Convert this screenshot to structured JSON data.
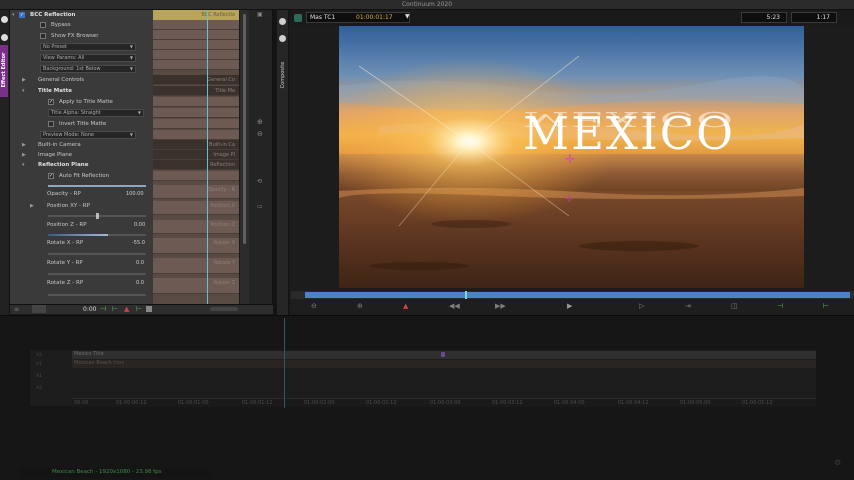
{
  "app": {
    "title": "Continuum 2020"
  },
  "side_tabs": {
    "effect_editor": "Effect Editor",
    "composite": "Composite"
  },
  "effect": {
    "name": "BCC Reflection",
    "bypass_label": "Bypass",
    "show_fx_browser_label": "Show FX Browser",
    "preset_value": "No Preset",
    "view_params_value": "View Params: All",
    "background_value": "Background: 1st Below",
    "general_controls": "General Controls",
    "title_matte": "Title Matte",
    "apply_to_title_matte": "Apply to Title Matte",
    "title_alpha_value": "Title Alpha: Straight",
    "invert_title_matte": "Invert Title Matte",
    "preview_mode_value": "Preview Mode: None",
    "built_in_camera": "Built-in Camera",
    "image_plane": "Image Plane",
    "reflection_plane": "Reflection Plane",
    "auto_fit_reflection": "Auto Fit Reflection",
    "params": [
      {
        "label": "Opacity - RP",
        "value": "100.00"
      },
      {
        "label": "Position XY - RP",
        "value": ""
      },
      {
        "label": "Position Z - RP",
        "value": "0.00"
      },
      {
        "label": "Rotate X - RP",
        "value": "-55.0"
      },
      {
        "label": "Rotate Y - RP",
        "value": "0.0"
      },
      {
        "label": "Rotate Z - RP",
        "value": "0.0"
      }
    ],
    "footer_timecode": "0:00"
  },
  "keyframes": {
    "header": "BCC Reflectio",
    "labels": [
      "General Co",
      "Title Ma",
      "Built-in Ca",
      "Image Pl",
      "Reflection",
      "Opacity - R",
      "Position X",
      "Position Z",
      "Rotate X",
      "Rotate Y",
      "Rotate Z"
    ]
  },
  "viewer": {
    "source_label": "Mas TC1",
    "timecode": "01:00:01:17",
    "duration_a": "5:23",
    "duration_b": "1:17",
    "title_text": "MEXICO"
  },
  "timeline": {
    "track_v1": "Mexico Title",
    "track_v2": "Mexican Beach mov",
    "ruler": [
      "00:00",
      "01:00:00:12",
      "01:00:01:00",
      "01:00:01:12",
      "01:00:02:00",
      "01:00:02:12",
      "01:00:03:00",
      "01:00:03:12",
      "01:00:04:00",
      "01:00:04:12",
      "01:00:05:00",
      "01:00:05:12"
    ],
    "status": "Mexican Beach - 1920x1080 - 23.98 fps"
  },
  "colors": {
    "effect_tab": "#7a2f88",
    "keyframe_header": "#b8a55a",
    "playhead": "#5fc6c8",
    "timeline_bar": "#4c83c4",
    "timecode": "#d8b341"
  }
}
